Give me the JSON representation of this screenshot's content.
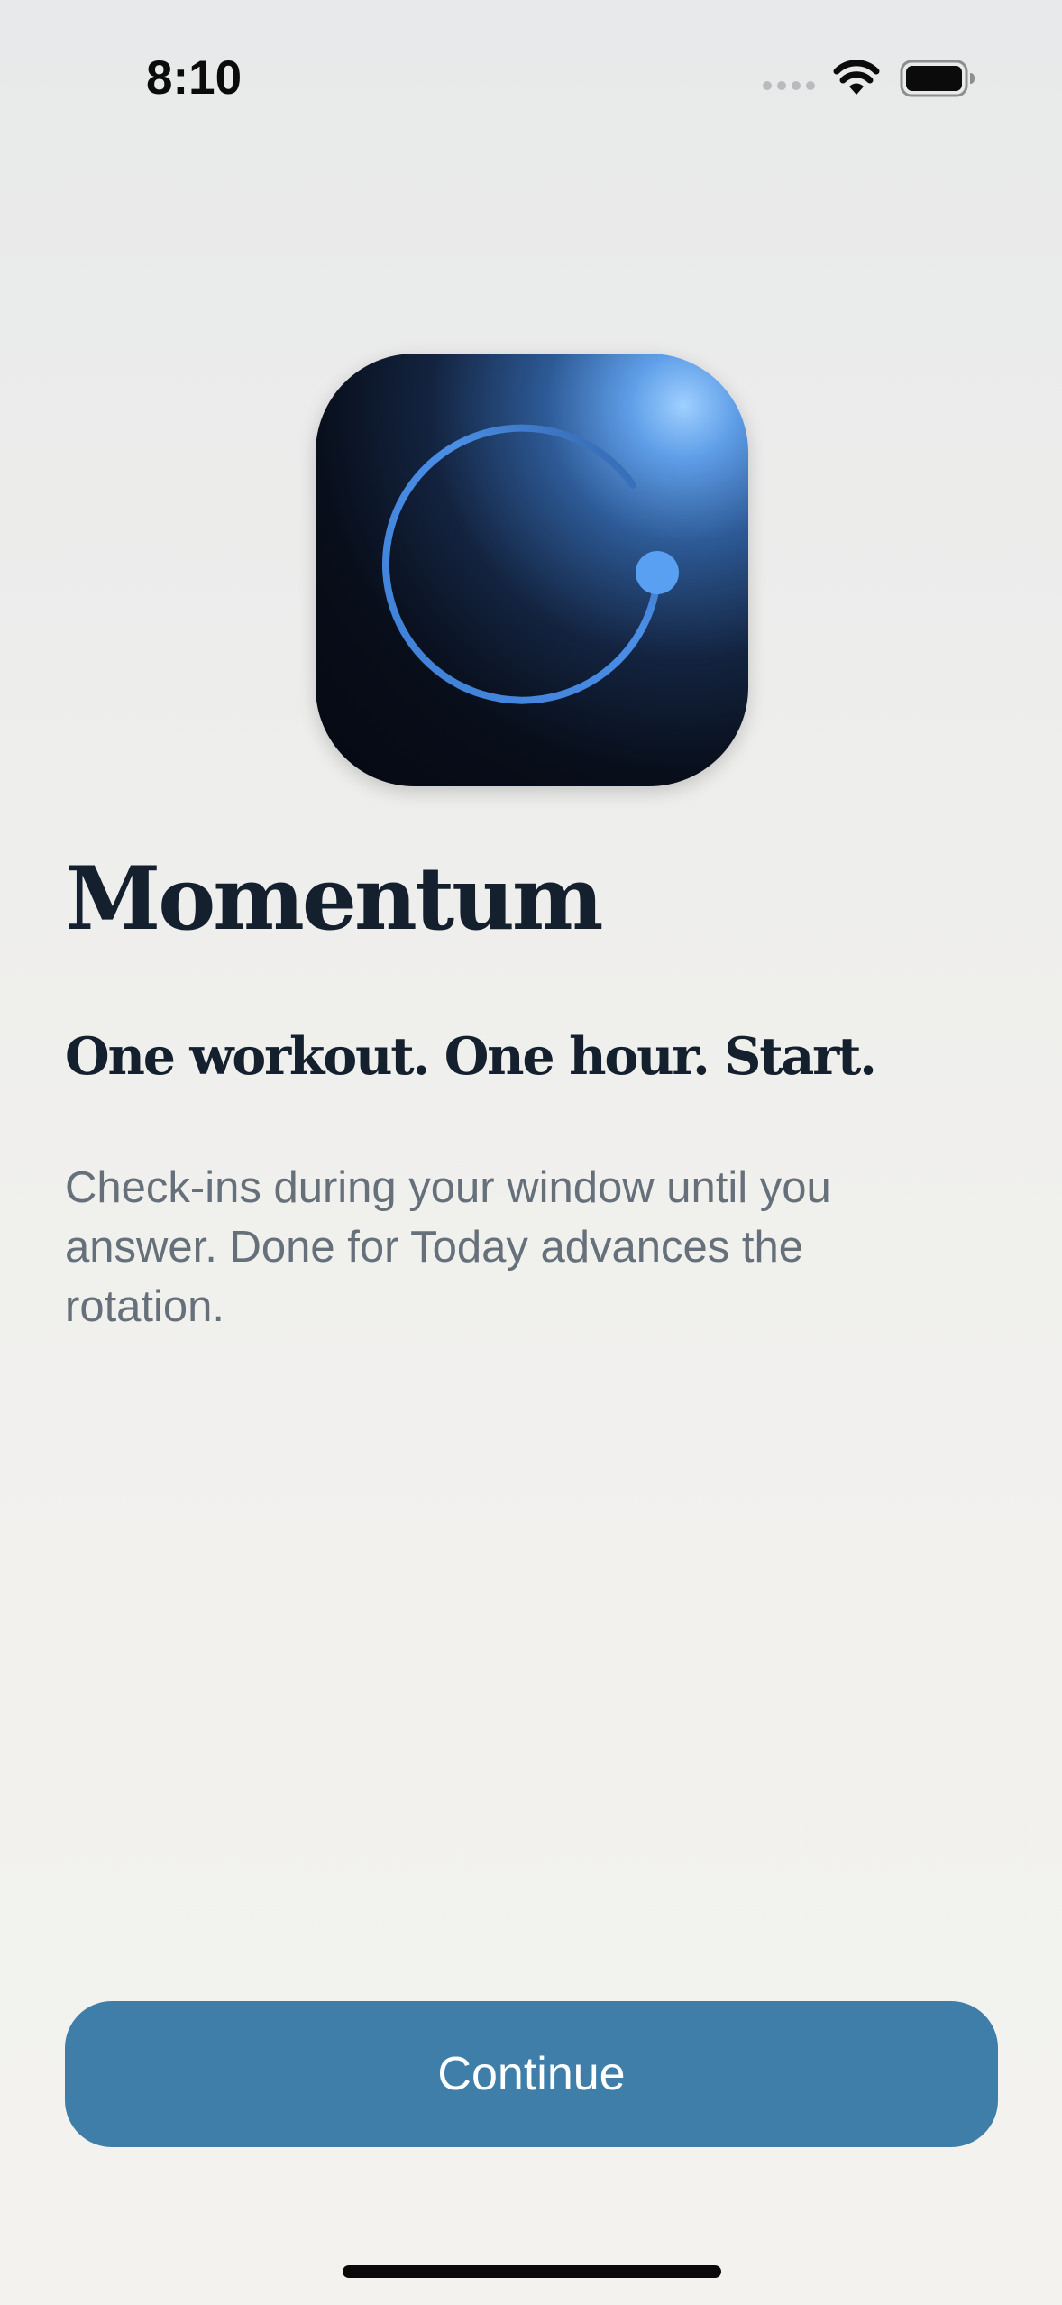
{
  "status_bar": {
    "time": "8:10",
    "icons": [
      "cellular-signal-icon",
      "wifi-icon",
      "battery-icon"
    ]
  },
  "app_icon": {
    "icon": "momentum-app-icon",
    "colors": {
      "background_dark": "#050912",
      "glow": "#9fd0ff",
      "ring": "#4a8ee6",
      "dot": "#5aa0f2"
    }
  },
  "onboarding": {
    "title": "Momentum",
    "tagline": "One workout. One hour. Start.",
    "description": "Check-ins during your window until you answer. Done for Today advances the rotation.",
    "continue_label": "Continue"
  },
  "colors": {
    "accent": "#3f7ea8",
    "title_text": "#14202e",
    "body_text": "#66707b"
  }
}
